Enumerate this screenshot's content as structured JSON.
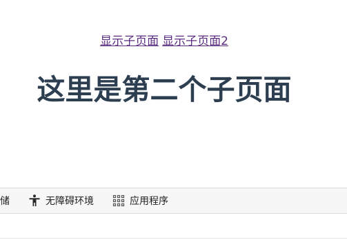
{
  "page": {
    "links": [
      "显示子页面",
      "显示子页面2"
    ],
    "heading": "这里是第二个子页面"
  },
  "toolbar": {
    "items": [
      {
        "label": "存储",
        "icon": "storage-icon"
      },
      {
        "label": "无障碍环境",
        "icon": "accessibility-icon"
      },
      {
        "label": "应用程序",
        "icon": "apps-grid-icon"
      }
    ]
  },
  "colors": {
    "link": "#5b2b80",
    "heading": "#2c3e50",
    "toolbar_bg": "#f7f7f7"
  }
}
